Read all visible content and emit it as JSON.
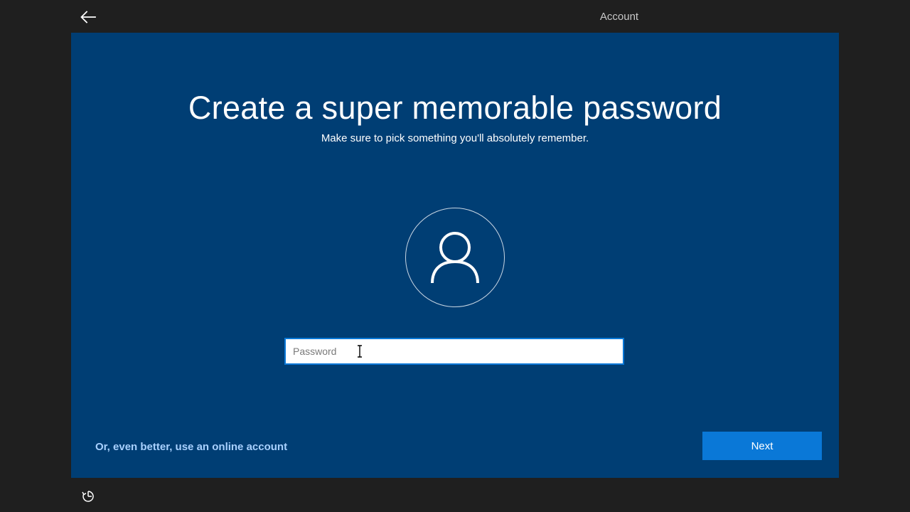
{
  "topbar": {
    "back_icon": "arrow-left-icon",
    "tab_label": "Account"
  },
  "main": {
    "title": "Create a super memorable password",
    "subtitle": "Make sure to pick something you'll absolutely remember.",
    "avatar_icon": "user-icon",
    "password": {
      "placeholder": "Password",
      "value": ""
    },
    "online_account_link": "Or, even better, use an online account",
    "next_label": "Next"
  },
  "footer": {
    "ease_of_access_icon": "ease-of-access-icon"
  },
  "colors": {
    "panel_background": "#003e74",
    "outer_background": "#1f1f1f",
    "accent": "#0a78d7",
    "link": "#a9d1ff"
  }
}
